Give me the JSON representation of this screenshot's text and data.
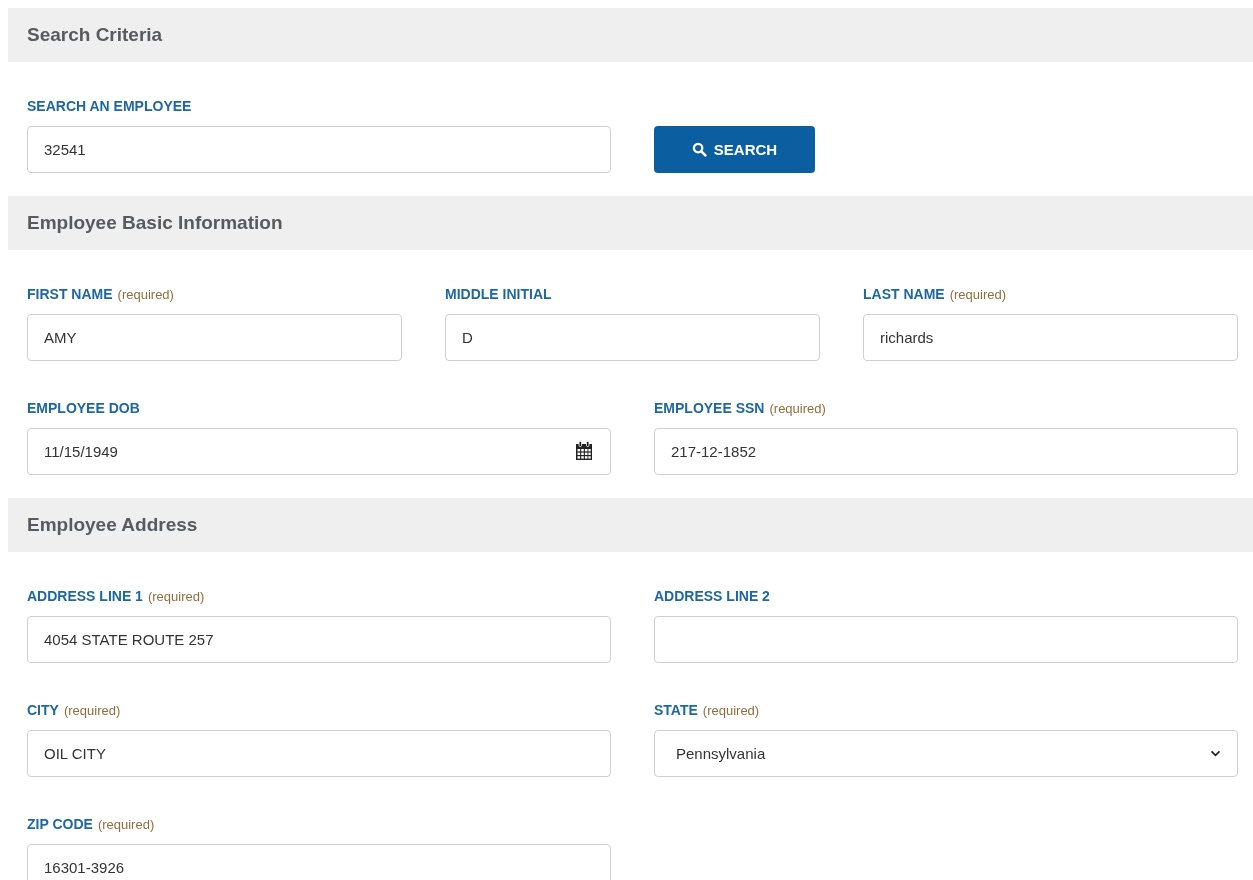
{
  "sections": [
    {
      "title": "Search Criteria",
      "rows": [
        {
          "fields": [
            {
              "kind": "text",
              "label": "SEARCH AN EMPLOYEE",
              "value": "32541"
            },
            {
              "kind": "button",
              "label": "SEARCH"
            }
          ]
        }
      ]
    },
    {
      "title": "Employee Basic Information",
      "rows": [
        {
          "fields": [
            {
              "kind": "text",
              "label": "FIRST NAME",
              "note": "(required)",
              "value": "AMY"
            },
            {
              "kind": "text",
              "label": "MIDDLE INITIAL",
              "value": "D"
            },
            {
              "kind": "text",
              "label": "LAST NAME",
              "note": "(required)",
              "value": "richards"
            }
          ]
        },
        {
          "fields": [
            {
              "kind": "date",
              "label": "EMPLOYEE DOB",
              "value": "11/15/1949"
            },
            {
              "kind": "text",
              "label": "EMPLOYEE SSN",
              "note": "(required)",
              "value": "217-12-1852"
            }
          ]
        }
      ]
    },
    {
      "title": "Employee Address",
      "rows": [
        {
          "fields": [
            {
              "kind": "text",
              "label": "ADDRESS LINE 1",
              "note": "(required)",
              "value": "4054 STATE ROUTE 257"
            },
            {
              "kind": "text",
              "label": "ADDRESS LINE 2"
            }
          ]
        },
        {
          "fields": [
            {
              "kind": "text",
              "label": "CITY",
              "note": "(required)",
              "value": "OIL CITY"
            },
            {
              "kind": "select",
              "label": "STATE",
              "note": "(required)",
              "value": "Pennsylvania"
            }
          ]
        },
        {
          "fields": [
            {
              "kind": "text",
              "label": "ZIP CODE",
              "note": "(required)",
              "value": "16301-3926"
            }
          ]
        }
      ]
    }
  ]
}
